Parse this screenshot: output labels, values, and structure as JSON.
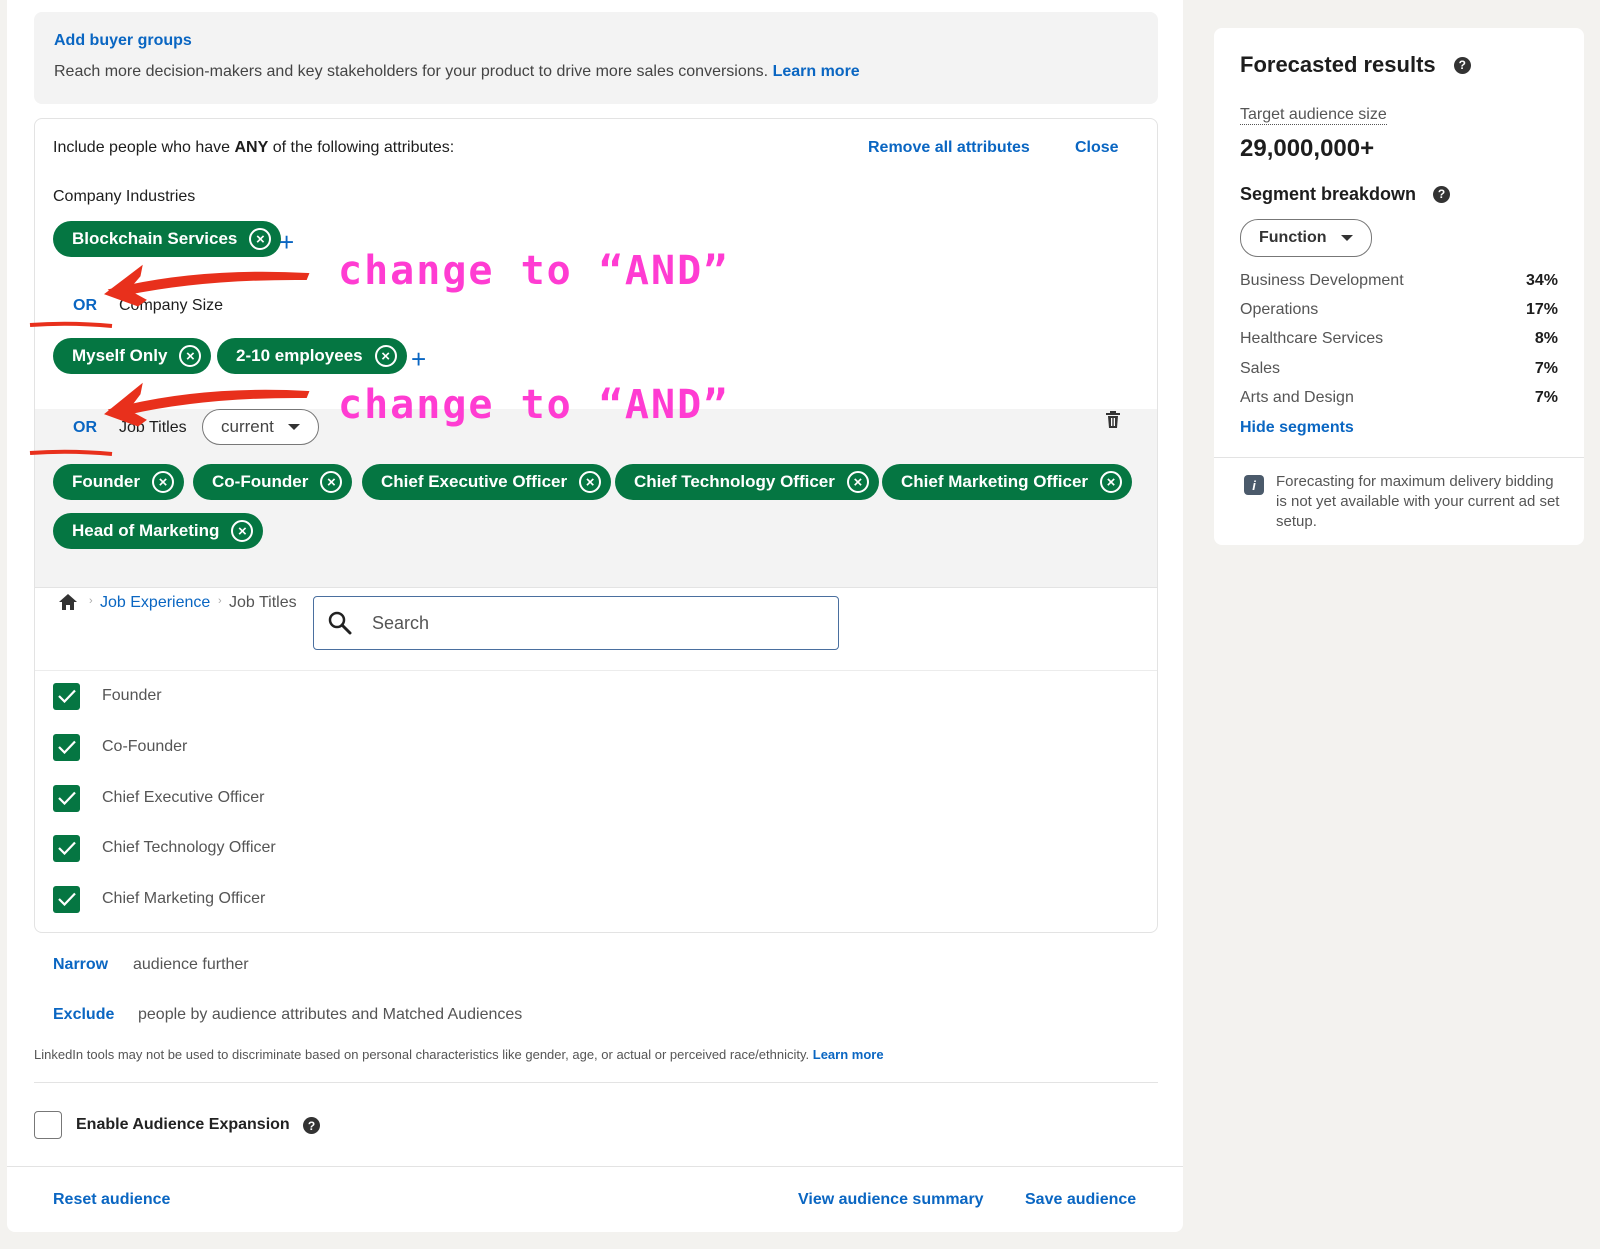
{
  "buyer_groups": {
    "title": "Add buyer groups",
    "description": "Reach more decision-makers and key stakeholders for your product to drive more sales conversions.",
    "learn_more": "Learn more"
  },
  "attributes": {
    "include_prefix": "Include people who have",
    "include_any": "ANY",
    "include_suffix": "of the following attributes:",
    "remove_all": "Remove all attributes",
    "close": "Close",
    "groups": [
      {
        "label": "Company Industries",
        "pills": [
          "Blockchain Services"
        ]
      },
      {
        "connector": "OR",
        "label": "Company Size",
        "pills": [
          "Myself Only",
          "2-10 employees"
        ]
      },
      {
        "connector": "OR",
        "label": "Job Titles",
        "dropdown": "current",
        "pills": [
          "Founder",
          "Co-Founder",
          "Chief Executive Officer",
          "Chief Technology Officer",
          "Chief Marketing Officer",
          "Head of Marketing"
        ]
      }
    ],
    "plus": "+",
    "remove_glyph": "×"
  },
  "annotations": [
    "change to “AND”",
    "change to “AND”"
  ],
  "browser": {
    "breadcrumb_1": "Job Experience",
    "breadcrumb_2": "Job Titles",
    "search_placeholder": "Search",
    "items": [
      "Founder",
      "Co-Founder",
      "Chief Executive Officer",
      "Chief Technology Officer",
      "Chief Marketing Officer"
    ]
  },
  "narrow": {
    "link": "Narrow",
    "text": "audience further"
  },
  "exclude": {
    "link": "Exclude",
    "text": "people by audience attributes and Matched Audiences"
  },
  "disclaimer": {
    "text": "LinkedIn tools may not be used to discriminate based on personal characteristics like gender, age, or actual or perceived race/ethnicity.",
    "learn_more": "Learn more"
  },
  "expansion": {
    "label": "Enable Audience Expansion"
  },
  "footer": {
    "reset": "Reset audience",
    "view_summary": "View audience summary",
    "save": "Save audience"
  },
  "forecast": {
    "title": "Forecasted results",
    "target_label": "Target audience size",
    "target_value": "29,000,000+",
    "segment_title": "Segment breakdown",
    "segment_dropdown": "Function",
    "segments": [
      {
        "name": "Business Development",
        "pct": "34%"
      },
      {
        "name": "Operations",
        "pct": "17%"
      },
      {
        "name": "Healthcare Services",
        "pct": "8%"
      },
      {
        "name": "Sales",
        "pct": "7%"
      },
      {
        "name": "Arts and Design",
        "pct": "7%"
      }
    ],
    "hide_segments": "Hide segments",
    "note": "Forecasting for maximum delivery bidding is not yet available with your current ad set setup."
  },
  "colors": {
    "pill": "#057642",
    "link": "#0a66c2",
    "annotation": "#ff3cd2",
    "arrow": "#e8301c"
  }
}
